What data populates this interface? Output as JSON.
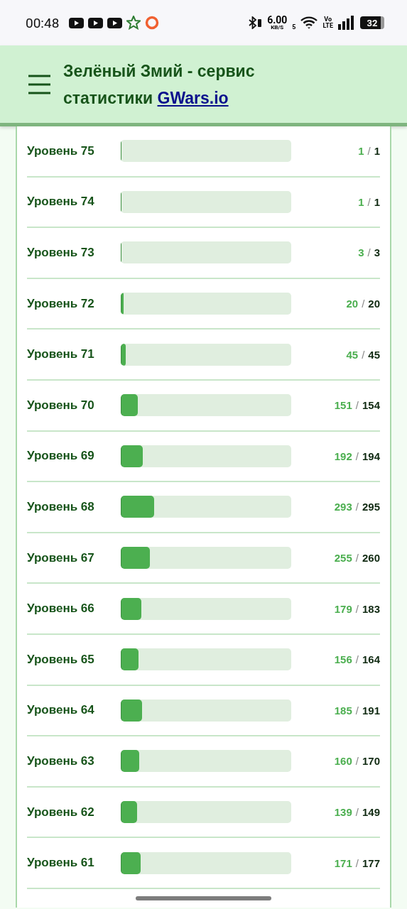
{
  "status_bar": {
    "time": "00:48",
    "speed": "6.00",
    "speed_unit": "KB/S",
    "wifi_band": "5",
    "volte_top": "Vo",
    "volte_bottom": "LTE",
    "battery": "32"
  },
  "header": {
    "title": "Зелёный Змий - сервис статистики",
    "link": "GWars.io"
  },
  "separator": "/",
  "levels": [
    {
      "label": "Уровень 75",
      "level": 0.005,
      "count": "1",
      "total": "1"
    },
    {
      "label": "Уровень 74",
      "level": 0.005,
      "count": "1",
      "total": "1"
    },
    {
      "label": "Уровень 73",
      "level": 0.005,
      "count": "3",
      "total": "3"
    },
    {
      "label": "Уровень 72",
      "level": 0.015,
      "count": "20",
      "total": "20"
    },
    {
      "label": "Уровень 71",
      "level": 0.03,
      "count": "45",
      "total": "45"
    },
    {
      "label": "Уровень 70",
      "level": 0.1,
      "count": "151",
      "total": "154"
    },
    {
      "label": "Уровень 69",
      "level": 0.13,
      "count": "192",
      "total": "194"
    },
    {
      "label": "Уровень 68",
      "level": 0.195,
      "count": "293",
      "total": "295"
    },
    {
      "label": "Уровень 67",
      "level": 0.17,
      "count": "255",
      "total": "260"
    },
    {
      "label": "Уровень 66",
      "level": 0.12,
      "count": "179",
      "total": "183"
    },
    {
      "label": "Уровень 65",
      "level": 0.105,
      "count": "156",
      "total": "164"
    },
    {
      "label": "Уровень 64",
      "level": 0.125,
      "count": "185",
      "total": "191"
    },
    {
      "label": "Уровень 63",
      "level": 0.11,
      "count": "160",
      "total": "170"
    },
    {
      "label": "Уровень 62",
      "level": 0.095,
      "count": "139",
      "total": "149"
    },
    {
      "label": "Уровень 61",
      "level": 0.115,
      "count": "171",
      "total": "177"
    }
  ]
}
